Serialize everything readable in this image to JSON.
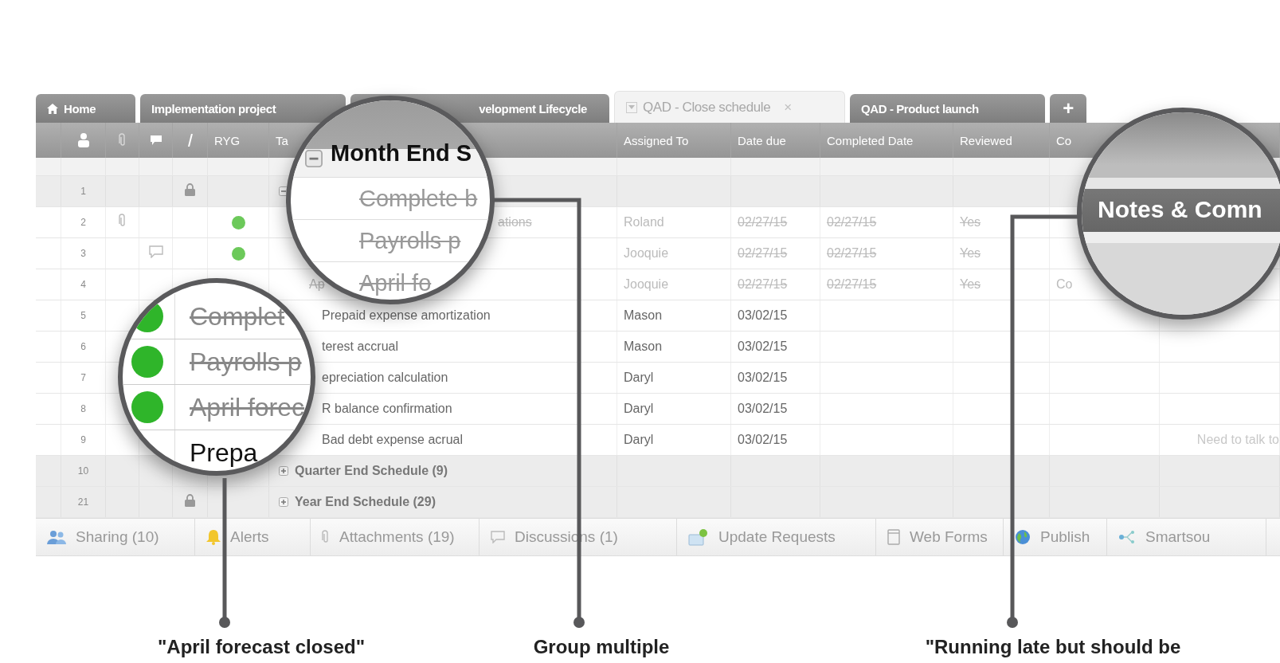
{
  "tabs": [
    {
      "label": "Home",
      "kind": "home",
      "selected": false
    },
    {
      "label": "Implementation project",
      "kind": "sheet",
      "selected": false
    },
    {
      "label": "velopment Lifecycle",
      "kind": "sheet",
      "selected": false
    },
    {
      "label": "QAD - Close schedule",
      "kind": "sheet",
      "selected": true,
      "close": "×"
    },
    {
      "label": "QAD - Product launch",
      "kind": "sheet",
      "selected": false
    },
    {
      "label": "+",
      "kind": "add",
      "selected": false
    }
  ],
  "columns": {
    "ryg": "RYG",
    "task": "Ta",
    "assigned": "Assigned To",
    "due": "Date due",
    "completed": "Completed Date",
    "reviewed": "Reviewed",
    "comments": "Co"
  },
  "rows": [
    {
      "num": "1",
      "kind": "group",
      "locked": true,
      "expanded": true
    },
    {
      "num": "2",
      "kind": "task",
      "attachment": true,
      "color": "#6cc95a",
      "task": "ations",
      "assigned": "Roland",
      "due": "02/27/15",
      "completed": "02/27/15",
      "reviewed": "Yes",
      "done": true
    },
    {
      "num": "3",
      "kind": "task",
      "comment": true,
      "color": "#6cc95a",
      "assigned": "Jooquie",
      "due": "02/27/15",
      "completed": "02/27/15",
      "reviewed": "Yes",
      "done": true
    },
    {
      "num": "4",
      "kind": "task",
      "task": "Ap",
      "assigned": "Jooquie",
      "due": "02/27/15",
      "completed": "02/27/15",
      "reviewed": "Yes",
      "comments": "Co",
      "done": true
    },
    {
      "num": "5",
      "kind": "task",
      "task": "Prepaid expense amortization",
      "assigned": "Mason",
      "due": "03/02/15",
      "done": false
    },
    {
      "num": "6",
      "kind": "task",
      "task": "terest accrual",
      "assigned": "Mason",
      "due": "03/02/15",
      "done": false
    },
    {
      "num": "7",
      "kind": "task",
      "task": "epreciation calculation",
      "assigned": "Daryl",
      "due": "03/02/15",
      "done": false
    },
    {
      "num": "8",
      "kind": "task",
      "task": "R balance confirmation",
      "assigned": "Daryl",
      "due": "03/02/15",
      "done": false
    },
    {
      "num": "9",
      "kind": "task",
      "task": "Bad debt expense acrual",
      "assigned": "Daryl",
      "due": "03/02/15",
      "notes": "Need to talk to",
      "done": false
    },
    {
      "num": "10",
      "kind": "group",
      "task": "Quarter End Schedule (9)",
      "expanded": false
    },
    {
      "num": "21",
      "kind": "group",
      "locked": true,
      "task": "Year End Schedule (29)",
      "expanded": false
    }
  ],
  "bottom_bar": [
    {
      "label": "Sharing (10)",
      "kind": "people"
    },
    {
      "label": "Alerts",
      "kind": "bell"
    },
    {
      "label": "Attachments (19)",
      "kind": "clip"
    },
    {
      "label": "Discussions (1)",
      "kind": "bubble"
    },
    {
      "label": "Update Requests",
      "kind": "update"
    },
    {
      "label": "Web Forms",
      "kind": "form"
    },
    {
      "label": "Publish",
      "kind": "globe"
    },
    {
      "label": "Smartsou",
      "kind": "share"
    }
  ],
  "magnifiers": [
    {
      "kind": "group",
      "header": "Month End S",
      "expanded": true,
      "items": [
        {
          "text": "Complete b",
          "done": true
        },
        {
          "text": "Payrolls p",
          "done": true
        },
        {
          "text": "April fo",
          "done": true
        }
      ]
    },
    {
      "kind": "rows",
      "items": [
        {
          "text": "Complet",
          "done": true,
          "color": "#2fb52a"
        },
        {
          "text": "Payrolls p",
          "done": true,
          "color": "#2fb52a"
        },
        {
          "text": "April forec",
          "done": true,
          "color": "#2fb52a"
        },
        {
          "text": "Prepa",
          "done": false
        }
      ]
    },
    {
      "kind": "column",
      "header": "Notes & Comn"
    }
  ],
  "captions": [
    "\"April forecast closed\"",
    "Group multiple",
    "\"Running late but should be"
  ]
}
